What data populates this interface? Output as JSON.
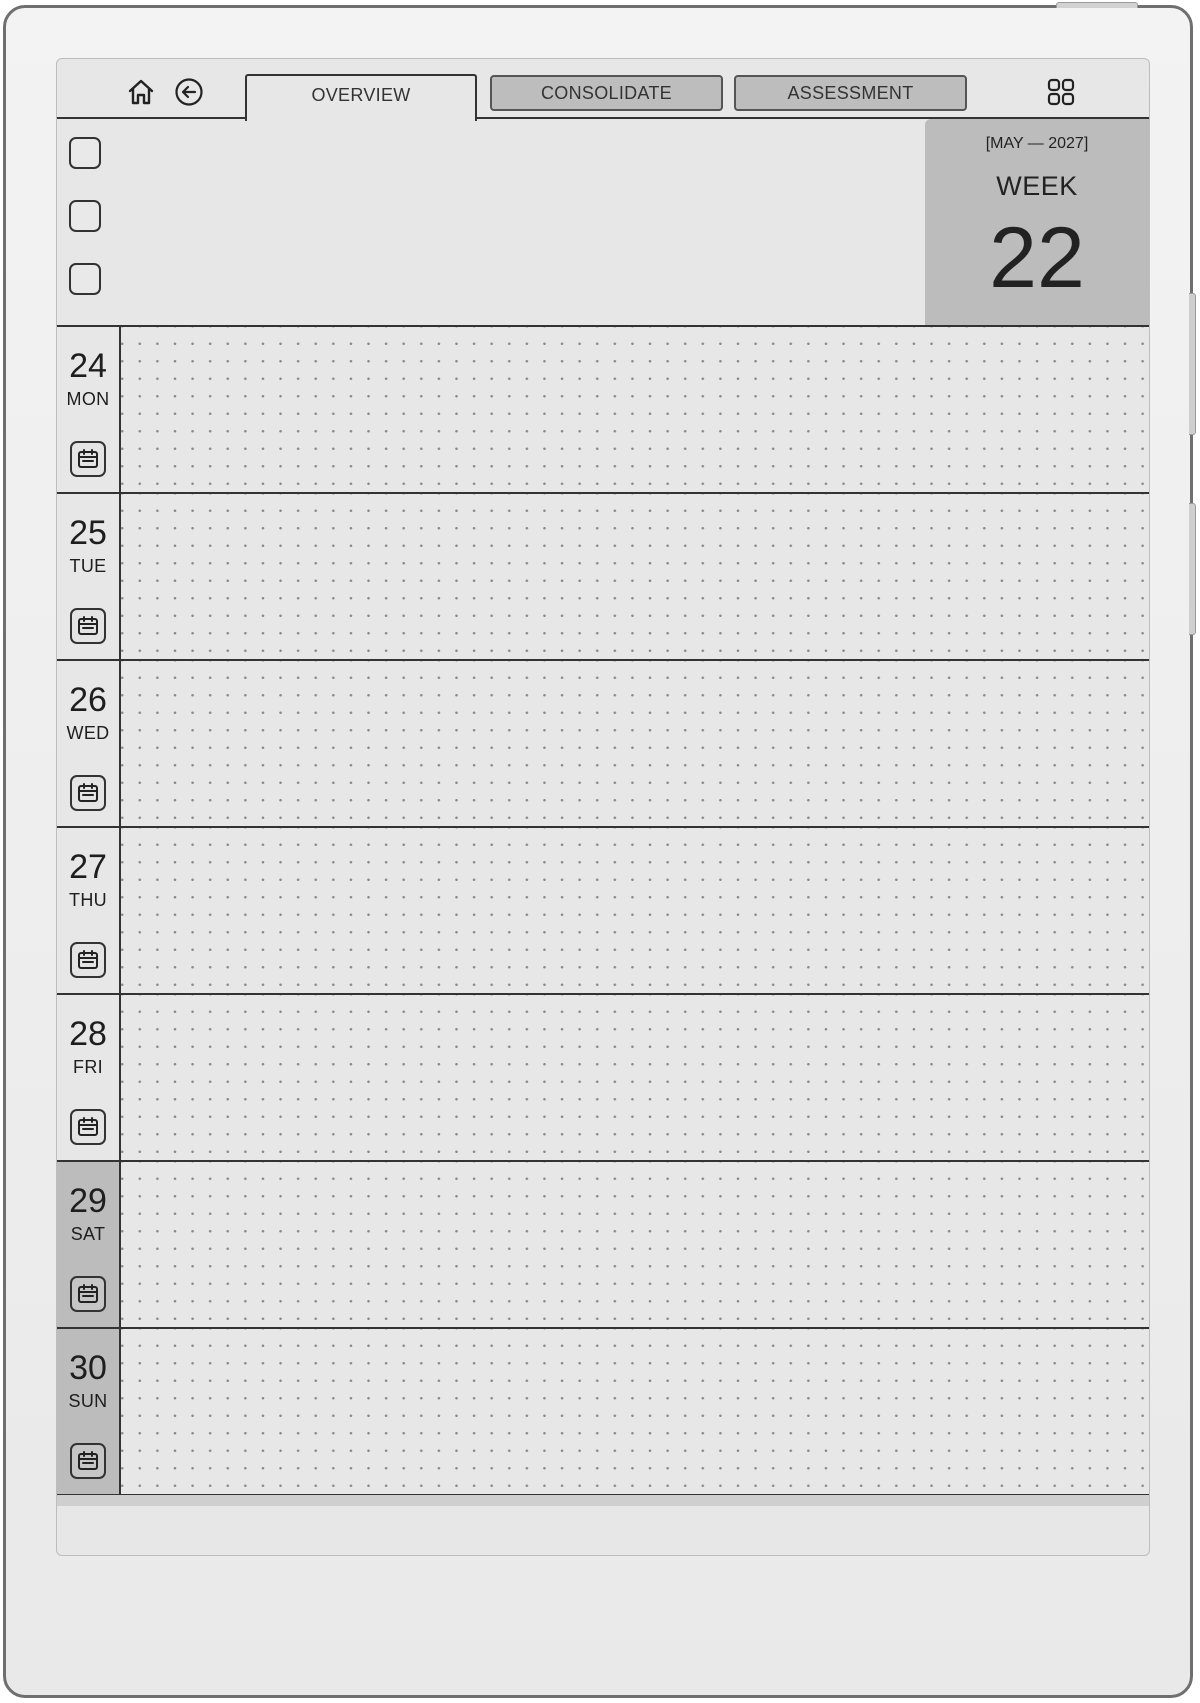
{
  "toolbar": {
    "icons": [
      "home-icon",
      "back-arrow-icon",
      "grid-menu-icon"
    ],
    "tabs": [
      {
        "label": "OVERVIEW",
        "active": true
      },
      {
        "label": "CONSOLIDATE",
        "active": false
      },
      {
        "label": "ASSESSMENT",
        "active": false
      }
    ]
  },
  "header": {
    "checkbox_count": 3,
    "month_range": "[MAY — 2027]",
    "week_label": "WEEK",
    "week_number": "22"
  },
  "days": [
    {
      "num": "24",
      "name": "MON",
      "weekend": false
    },
    {
      "num": "25",
      "name": "TUE",
      "weekend": false
    },
    {
      "num": "26",
      "name": "WED",
      "weekend": false
    },
    {
      "num": "27",
      "name": "THU",
      "weekend": false
    },
    {
      "num": "28",
      "name": "FRI",
      "weekend": false
    },
    {
      "num": "29",
      "name": "SAT",
      "weekend": true
    },
    {
      "num": "30",
      "name": "SUN",
      "weekend": true
    }
  ],
  "colors": {
    "ink": "#1e1e1e",
    "screen": "#e7e7e7",
    "weekend_shade": "#bcbcbc",
    "tab_inactive": "#bdbdbd"
  }
}
